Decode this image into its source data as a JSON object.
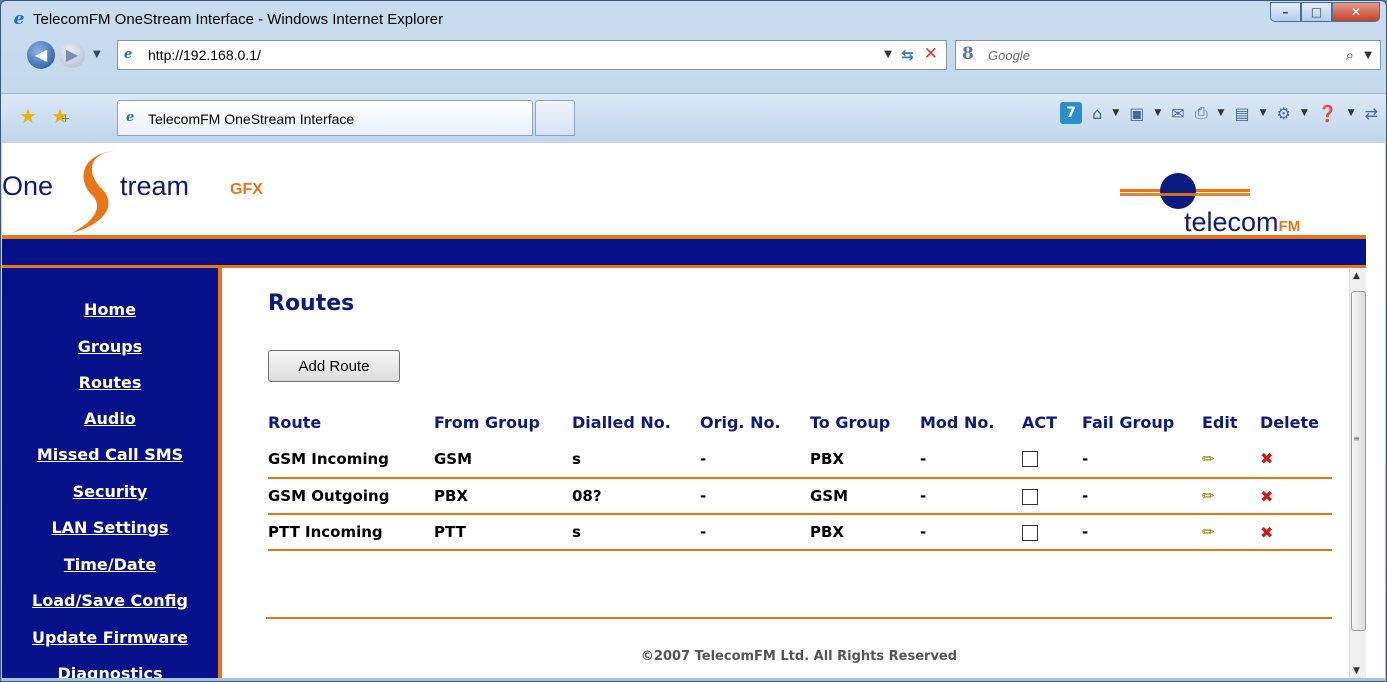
{
  "window": {
    "title": "TelecomFM OneStream Interface - Windows Internet Explorer",
    "min": "–",
    "max": "□",
    "close": "✕"
  },
  "addressbar": {
    "url": "http://192.168.0.1/",
    "search_placeholder": "Google",
    "search_glyph": "8"
  },
  "tabs": [
    {
      "label": "TelecomFM OneStream Interface"
    }
  ],
  "commandbar": {
    "badge": "7"
  },
  "header": {
    "logo_one": "One",
    "logo_tream": "tream",
    "logo_gfx": "GFX",
    "tfm_text": "telecom",
    "tfm_fm": "FM"
  },
  "sidebar": {
    "items": [
      {
        "label": "Home"
      },
      {
        "label": "Groups"
      },
      {
        "label": "Routes"
      },
      {
        "label": "Audio"
      },
      {
        "label": "Missed Call SMS"
      },
      {
        "label": "Security"
      },
      {
        "label": "LAN Settings"
      },
      {
        "label": "Time/Date"
      },
      {
        "label": "Load/Save Config"
      },
      {
        "label": "Update Firmware"
      },
      {
        "label": "Diagnostics"
      }
    ]
  },
  "main": {
    "title": "Routes",
    "add_button": "Add Route",
    "columns": [
      "Route",
      "From Group",
      "Dialled No.",
      "Orig. No.",
      "To Group",
      "Mod No.",
      "ACT",
      "Fail Group",
      "Edit",
      "Delete"
    ],
    "rows": [
      {
        "route": "GSM Incoming",
        "from": "GSM",
        "dialled": "s",
        "orig": "-",
        "to": "PBX",
        "mod": "-",
        "act": false,
        "fail": "-"
      },
      {
        "route": "GSM Outgoing",
        "from": "PBX",
        "dialled": "08?",
        "orig": "-",
        "to": "GSM",
        "mod": "-",
        "act": false,
        "fail": "-"
      },
      {
        "route": "PTT Incoming",
        "from": "PTT",
        "dialled": "s",
        "orig": "-",
        "to": "PBX",
        "mod": "-",
        "act": false,
        "fail": "-"
      }
    ],
    "footer": "©2007 TelecomFM Ltd. All Rights Reserved"
  }
}
